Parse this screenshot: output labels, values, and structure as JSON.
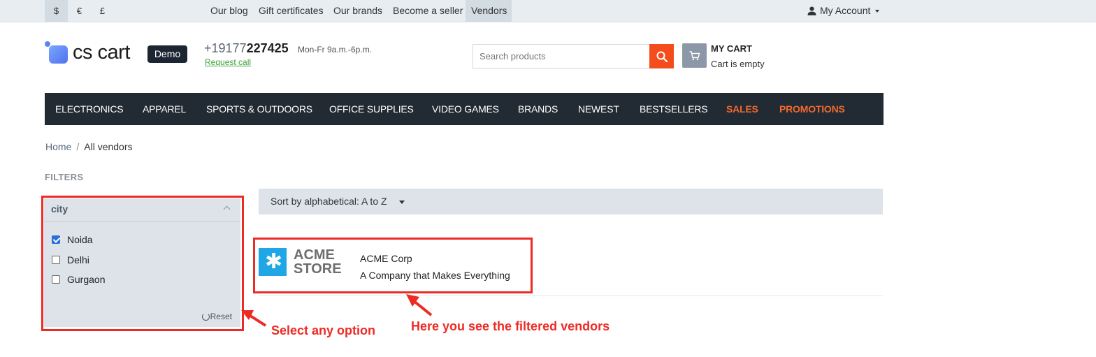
{
  "topbar": {
    "currencies": [
      "$",
      "€",
      "£"
    ],
    "links": [
      "Our blog",
      "Gift certificates",
      "Our brands",
      "Become a seller",
      "Vendors"
    ],
    "account_label": "My Account"
  },
  "header": {
    "logo_text": "cs cart",
    "demo_badge": "Demo",
    "phone_prefix": "+19177",
    "phone_bold": "227425",
    "hours": "Mon-Fr 9a.m.-6p.m.",
    "request_call": "Request call",
    "search_placeholder": "Search products",
    "cart_title": "MY CART",
    "cart_status": "Cart is empty"
  },
  "nav": {
    "items": [
      "ELECTRONICS",
      "APPAREL",
      "SPORTS & OUTDOORS",
      "OFFICE SUPPLIES",
      "VIDEO GAMES",
      "BRANDS",
      "NEWEST",
      "BESTSELLERS",
      "SALES",
      "PROMOTIONS"
    ]
  },
  "breadcrumb": {
    "home": "Home",
    "separator": "/",
    "current": "All vendors"
  },
  "filters": {
    "title": "FILTERS",
    "name": "city",
    "options": [
      {
        "label": "Noida",
        "checked": true
      },
      {
        "label": "Delhi",
        "checked": false
      },
      {
        "label": "Gurgaon",
        "checked": false
      }
    ],
    "reset_label": "Reset"
  },
  "sort": {
    "label": "Sort by alphabetical: A to Z"
  },
  "vendor": {
    "logo_line1": "ACME",
    "logo_line2": "STORE",
    "name": "ACME Corp",
    "description": "A Company that Makes Everything"
  },
  "annotations": {
    "select_hint": "Select any option",
    "result_hint": "Here you see the filtered vendors"
  },
  "colors": {
    "accent": "#f34d1e",
    "nav_bg": "#222a33",
    "hot_link": "#f26a2e",
    "annotation": "#ee2a24"
  }
}
